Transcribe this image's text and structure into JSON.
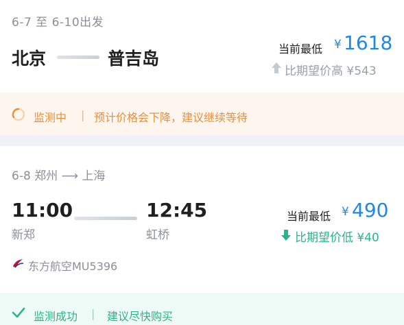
{
  "watch1": {
    "date_range": "6-7 至 6-10出发",
    "from_city": "北京",
    "to_city": "普吉岛",
    "lowest_label": "当前最低",
    "currency": "¥",
    "price": "1618",
    "compare_text": "比期望价高 ¥543",
    "compare_direction": "up",
    "status": "监测中",
    "separator": "|",
    "advice": "预计价格会下降，建议继续等待"
  },
  "watch2": {
    "route": "6-8 郑州 ⟶ 上海",
    "dep_time": "11:00",
    "arr_time": "12:45",
    "dep_airport": "新郑",
    "arr_airport": "虹桥",
    "lowest_label": "当前最低",
    "currency": "¥",
    "price": "490",
    "compare_text": "比期望价低 ¥40",
    "compare_direction": "down",
    "airline": "东方航空MU5396",
    "status": "监测成功",
    "separator": "|",
    "advice": "建议尽快购买"
  },
  "colors": {
    "price_blue": "#1d87e6",
    "warning_orange": "#e8903f",
    "success_green": "#2bb38b",
    "muted_gray": "#8a8f99"
  },
  "icons": {
    "up": "arrow-up-icon",
    "down": "arrow-down-icon",
    "monitoring": "loading-ring-icon",
    "success": "checkmark-icon",
    "airline": "china-eastern-logo-icon"
  }
}
